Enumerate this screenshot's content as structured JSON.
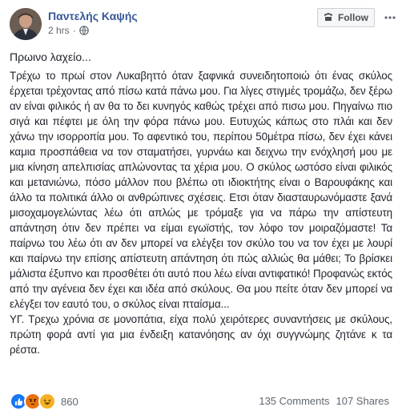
{
  "post": {
    "author": "Παντελής Καψής",
    "time": "2 hrs",
    "privacy_icon": "globe-icon",
    "follow_label": "Follow",
    "title": "Πρωινο λαχείο...",
    "paragraphs": [
      "Τρέχω το πρωί στον Λυκαβηττό όταν ξαφνικά συνειδητοποιώ ότι ένας σκύλος έρχεται τρέχοντας από πίσω κατά πάνω μου. Για λίγες στιγμές τρομάζω, δεν ξέρω αν είναι φιλικός ή αν θα το δει κυνηγός καθώς τρέχει από πισω μου. Πηγαίνω πιο σιγά και πέφτει με όλη την φόρα πάνω μου. Ευτυχώς κάπως στο πλάι και δεν χάνω την ισορροπία μου. Το αφεντικό του, περίπου 50μέτρα πίσω, δεν έχει κάνει καμια προσπάθεια να τον σταματήσει, γυρνάω και δειχνω την ενόχλησή μου με μια κίνηση απελπισίας απλώνοντας τα χέρια μου. Ο σκύλος ωστόσο είναι φιλικός και μετανιώνω, πόσο μάλλον που βλέπω οτι ιδιοκτήτης είναι ο Βαρουφάκης και άλλο τα πολιτικά άλλο οι ανθρώπινες σχέσεις. Ετσι όταν διασταυρωνόμαστε ξανά μισοχαμογελώντας λέω ότι απλώς με τρόμαξε για να πάρω την απίστευτη απάντηση ότιν δεν πρέπει να είμαι εγωϊστής, τον λόφο τον μοιραζόμαστε! Τα παίρνω του λέω ότι αν δεν μπορεί να ελέγξει τον σκύλο του να τον έχει με λουρί και παίρνω την επίσης απίστευτη απάντηση ότι πώς αλλιώς θα μάθει; Το βρίσκει μάλιστα έξυπνο και προσθέτει ότι αυτό που λέω είναι αντιφατικό! Προφανώς εκτός από την αγένεια δεν έχει και ιδέα από σκύλους. Θα μου πείτε όταν δεν μπορεί να ελέγξει τον εαυτό του, ο σκύλος είναι πταίσμα...",
      "ΥΓ. Τρεχω χρόνια σε μονοπάτια, είχα πολύ χειρότερες συναντήσεις με σκύλους, πρώτη φορά αντί για μια ένδειξη κατανόησης αν όχι συγγνώμης ζητάνε κ τα ρέστα."
    ],
    "reactions": {
      "types": [
        "like",
        "angry",
        "haha"
      ],
      "colors": {
        "like": "#1877f2",
        "angry": "#e9710f",
        "haha": "#f7b125"
      },
      "count": "860"
    },
    "comments_label": "135 Comments",
    "shares_label": "107 Shares"
  }
}
